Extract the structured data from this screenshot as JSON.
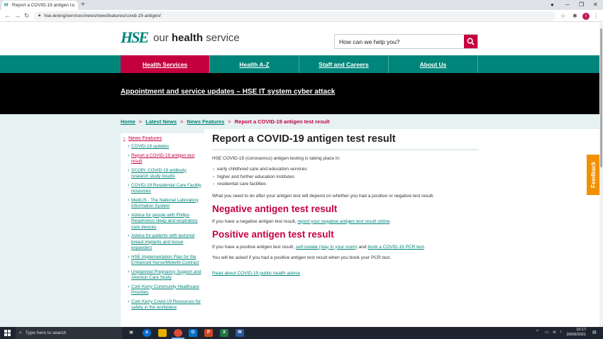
{
  "browser": {
    "tab_title": "Report a COVID-19 antigen test r",
    "url": "hse.ie/eng/services/news/newsfeatures/covid-19-antigen/",
    "favicon_text": "H",
    "avatar_letter": "I"
  },
  "header": {
    "logo_mark": "HSE",
    "logo_text_prefix": "our",
    "logo_text_bold": "health",
    "logo_text_suffix": "service",
    "search_placeholder": "How can we help you?"
  },
  "nav": {
    "items": [
      {
        "label": "Health Services"
      },
      {
        "label": "Health A-Z"
      },
      {
        "label": "Staff and Careers"
      },
      {
        "label": "About Us"
      }
    ]
  },
  "alert": {
    "text": "Appointment and service updates – HSE IT system cyber attack"
  },
  "breadcrumb": {
    "items": [
      "Home",
      "Latest News",
      "News Features"
    ],
    "current": "Report a COVID-19 antigen test result",
    "separator": ">"
  },
  "sidebar": {
    "heading": "News Features",
    "items": [
      {
        "label": "COVID-19 updates"
      },
      {
        "label": "Report a COVID-19 antigen test result"
      },
      {
        "label": "SCOPI: COVID-19 antibody research study results"
      },
      {
        "label": "COVID-19 Residential Care Facility resources"
      },
      {
        "label": "MedLIS - The National Laboratory Information System"
      },
      {
        "label": "Advice for people with Philips Respironics sleep and respiratory care devices"
      },
      {
        "label": "Advice for patients with textured breast implants and tissue expanders"
      },
      {
        "label": "HSE Implementation Plan for the Enhanced Nurse/Midwife Contract"
      },
      {
        "label": "Unplanned Pregnancy Support and Abortion Care Study"
      },
      {
        "label": "Cork Kerry Community Healthcare Priorities"
      },
      {
        "label": "Cork Kerry Covid-19 Resources for safety in the workplace"
      }
    ]
  },
  "content": {
    "title": "Report a COVID-19 antigen test result",
    "intro": "HSE COVID-19 (coronavirus) antigen testing is taking place in:",
    "bullets": [
      "early childhood care and education services",
      "higher and further education institutes",
      "residential care facilities"
    ],
    "depends": "What you need to do after your antigen test will depend on whether you had a positive or negative test result.",
    "neg_heading": "Negative antigen test result",
    "neg_text": "If you have a negative antigen test result,",
    "neg_link": "report your negative antigen test result online",
    "neg_end": ".",
    "pos_heading": "Positive antigen test result",
    "pos_text": "If you have a positive antigen test result,",
    "pos_link1": "self-isolate (stay in your room)",
    "pos_and": "and",
    "pos_link2": "book a COVID-19 PCR test",
    "pos_end": ".",
    "pcr_note": "You will be asked if you had a positive antigen test result when you book your PCR test.",
    "public_advice_link": "Read about COVID-19 public health advice"
  },
  "feedback": {
    "label": "Feedback"
  },
  "taskbar": {
    "search_placeholder": "Type here to search",
    "time": "16:17",
    "date": "20/09/2021"
  },
  "colors": {
    "teal": "#00857a",
    "crimson": "#c4003e",
    "orange": "#f29100"
  }
}
